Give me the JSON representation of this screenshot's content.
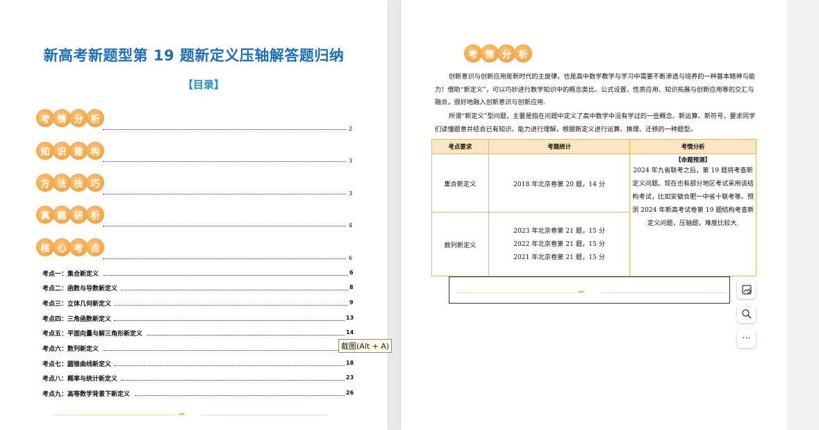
{
  "left_page": {
    "title": "新高考新题型第 19 题新定义压轴解答题归纳",
    "toc_heading": "【目录】",
    "sections": [
      {
        "chars": [
          "考",
          "情",
          "分",
          "析"
        ],
        "page": "2"
      },
      {
        "chars": [
          "知",
          "识",
          "建",
          "构"
        ],
        "page": "3"
      },
      {
        "chars": [
          "方",
          "法",
          "技",
          "巧"
        ],
        "page": "3"
      },
      {
        "chars": [
          "真",
          "题",
          "研",
          "析"
        ],
        "page": "4"
      },
      {
        "chars": [
          "核",
          "心",
          "考",
          "点"
        ],
        "page": "6"
      }
    ],
    "items": [
      {
        "label": "考点一：集合新定义",
        "page": "6"
      },
      {
        "label": "考点二：函数与导数新定义",
        "page": "8"
      },
      {
        "label": "考点三：立体几何新定义",
        "page": "9"
      },
      {
        "label": "考点四：三角函数新定义",
        "page": "13"
      },
      {
        "label": "考点五：平面向量与解三角形新定义",
        "page": "14"
      },
      {
        "label": "考点六：数列新定义",
        "page": ""
      },
      {
        "label": "考点七：圆锥曲线新定义",
        "page": "18"
      },
      {
        "label": "考点八：概率与统计新定义",
        "page": "23"
      },
      {
        "label": "考点九：高等数学背景下新定义",
        "page": "26"
      }
    ],
    "footer_arrows": "▸▸▸"
  },
  "tooltip": "截图(Alt + A)",
  "right_page": {
    "badge_chars": [
      "考",
      "情",
      "分",
      "析"
    ],
    "paragraph1": "创新意识与创新应用是新时代的主旋律，也是高中数学教学与学习中需要不断渗透与培养的一种基本精神与能力！借助“新定义”，可以巧妙进行数学知识中的概念类比、公式设置、性质应用、知识拓展与创新应用等的交汇与融合，很好地融入创新意识与创新应用.",
    "paragraph2": "所谓“新定义”型问题，主要是指在问题中定义了高中数学中没有学过的一些概念、新运算、新符号，要求同学们读懂题意并结合已有知识、能力进行理解，根据新定义进行运算、推理、迁移的一种题型。",
    "table": {
      "headers": [
        "考点要求",
        "考题统计",
        "考情分析"
      ],
      "rows": [
        {
          "requirement": "集合新定义",
          "stats": [
            "2018 年北京卷第 20 题，14 分"
          ]
        },
        {
          "requirement": "数列新定义",
          "stats": [
            "2023 年北京卷第 21 题，15 分",
            "2022 年北京卷第 21 题，15 分",
            "2021 年北京卷第 21 题，15 分"
          ]
        }
      ],
      "analysis_title": "【命题预测】",
      "analysis_text": "2024 年九省联考之后，第 19 题将考查新定义问题。现在也有部分地区考试采用该结构考试，比如安徽合肥一中省十联考等。预测 2024 年新高考试卷第 19 题结构考查新定义问题，压轴题，难度比较大."
    },
    "footer_arrows": "▸▸▸"
  },
  "side_toolbar": {
    "edit_icon": "image-edit-icon",
    "search_icon": "search-icon",
    "more_label": "···"
  }
}
